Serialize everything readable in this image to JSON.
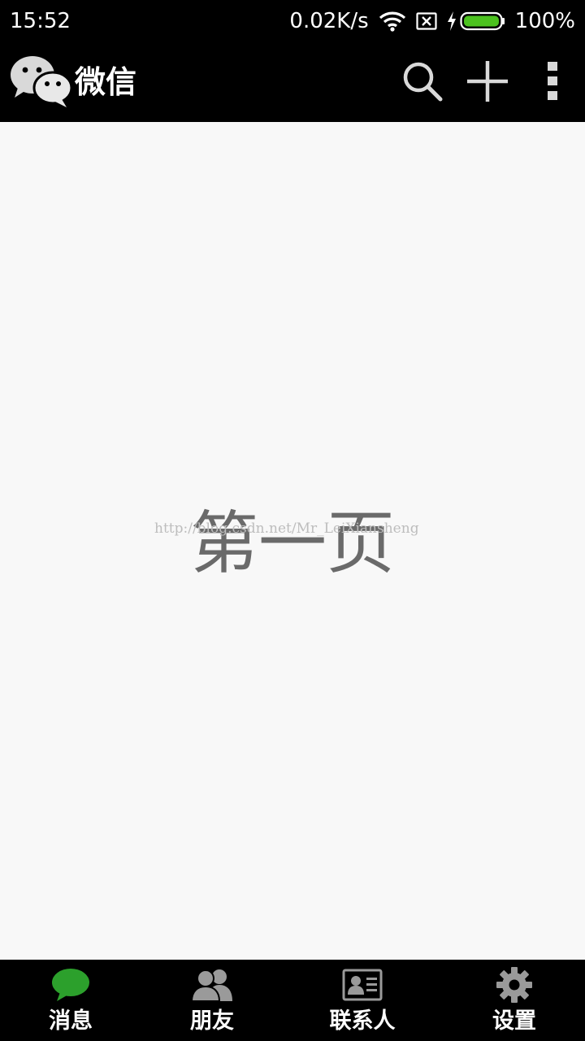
{
  "status_bar": {
    "time": "15:52",
    "net_speed": "0.02K/s",
    "battery_level": "100%",
    "icons": [
      "wifi-icon",
      "no-sim-icon",
      "charging-icon",
      "battery-icon"
    ],
    "battery_color": "#4cc21f"
  },
  "app_bar": {
    "title": "微信",
    "logo_icon": "wechat-logo-icon",
    "actions": [
      "search-icon",
      "plus-icon",
      "more-vertical-icon"
    ]
  },
  "content": {
    "page_label": "第一页",
    "watermark": "http://blog.csdn.net/Mr_LeiXiansheng"
  },
  "bottom_nav": {
    "active_color": "#2ca02c",
    "items": [
      {
        "label": "消息",
        "icon": "chat-bubble-icon",
        "active": true
      },
      {
        "label": "朋友",
        "icon": "friends-icon",
        "active": false
      },
      {
        "label": "联系人",
        "icon": "contact-card-icon",
        "active": false
      },
      {
        "label": "设置",
        "icon": "gear-icon",
        "active": false
      }
    ]
  }
}
